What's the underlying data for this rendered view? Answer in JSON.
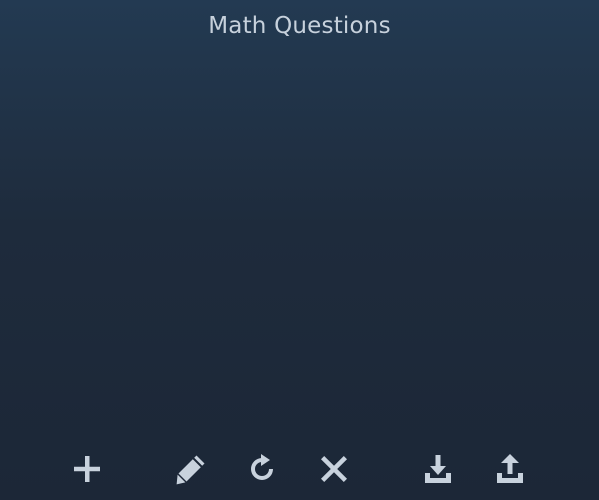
{
  "header": {
    "title": "Math Questions"
  },
  "toolbar": {
    "buttons": [
      {
        "name": "add",
        "icon": "plus-icon"
      },
      {
        "name": "edit",
        "icon": "pencil-icon"
      },
      {
        "name": "refresh",
        "icon": "refresh-icon"
      },
      {
        "name": "delete",
        "icon": "close-icon"
      },
      {
        "name": "download",
        "icon": "download-icon"
      },
      {
        "name": "upload",
        "icon": "upload-icon"
      }
    ]
  },
  "colors": {
    "background_top": "#233a52",
    "background_bottom": "#1c2737",
    "text": "#c7d1dc",
    "icon": "#c8d2dd"
  }
}
